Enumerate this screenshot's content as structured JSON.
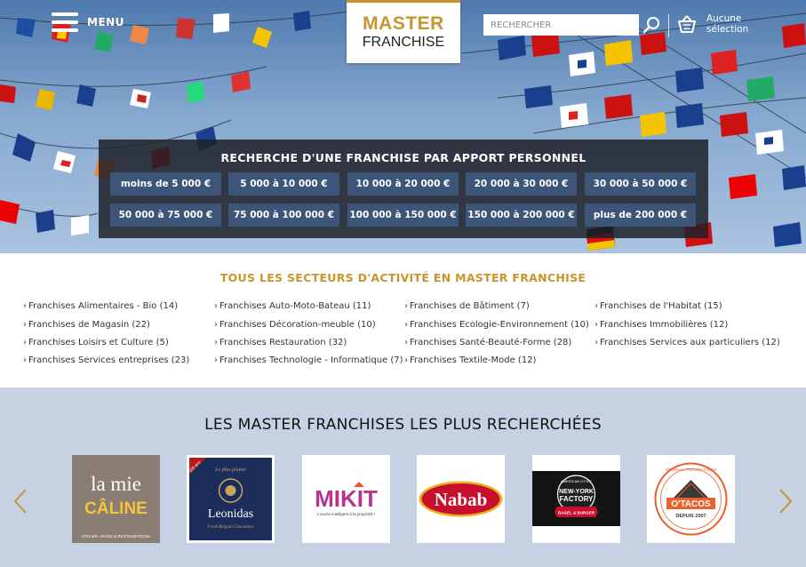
{
  "header": {
    "menu_label": "MENU",
    "logo_line1": "MASTER",
    "logo_line2": "FRANCHISE",
    "search_placeholder": "RECHERCHER",
    "cart_line1": "Aucune",
    "cart_line2": "sélection"
  },
  "apport": {
    "title": "RECHERCHE D'UNE FRANCHISE PAR APPORT PERSONNEL",
    "buttons": [
      "moins de 5 000  €",
      "5 000 à 10 000  €",
      "10 000 à 20 000  €",
      "20 000 à 30 000  €",
      "30 000 à 50 000  €",
      "50 000 à 75 000  €",
      "75 000 à 100 000  €",
      "100 000 à 150 000  €",
      "150 000 à 200 000  €",
      "plus de 200 000  €"
    ]
  },
  "sectors": {
    "title": "TOUS LES SECTEURS D'ACTIVITÉ EN MASTER FRANCHISE",
    "items": [
      "Franchises Alimentaires - Bio (14)",
      "Franchises Auto-Moto-Bateau (11)",
      "Franchises de Bâtiment (7)",
      "Franchises de l'Habitat (15)",
      "Franchises de Magasin (22)",
      "Franchises Décoration-meuble (10)",
      "Franchises Ecologie-Environnement (10)",
      "Franchises Immobilières (12)",
      "Franchises Loisirs et Culture (5)",
      "Franchises Restauration (32)",
      "Franchises Santé-Beauté-Forme (28)",
      "Franchises Services aux particuliers (12)",
      "Franchises Services entreprises (23)",
      "Franchises Technologie - Informatique (7)",
      "Franchises Textile-Mode (12)"
    ]
  },
  "popular": {
    "title": "LES MASTER FRANCHISES LES PLUS RECHERCHÉES",
    "brands": [
      {
        "name": "la mie CÂLINE",
        "line1": "la mie",
        "line2": "CÂLINE",
        "tagline": "ATELIER «PAINS & RESTAURATION»"
      },
      {
        "name": "Leonidas",
        "badge": "100 ans",
        "top": "Le plus plaisir",
        "line1": "Leonidas",
        "tagline": "Fresh Belgian Chocolates"
      },
      {
        "name": "MIKIT",
        "line1": "MIKIT",
        "tagline": "L'accès intelligent à la propriété !"
      },
      {
        "name": "Nabab",
        "line1": "Nabab"
      },
      {
        "name": "New-York Factory",
        "arc": "AMERICAN STYLE",
        "line1": "NEW-YORK",
        "line2": "FACTORY",
        "tagline": "BAGEL & BURGER"
      },
      {
        "name": "O'TACOS",
        "arc": "ORIGINAL FRENCH TACOS",
        "line1": "O'TACOS",
        "line2": "DEPUIS 2007"
      }
    ]
  },
  "colors": {
    "gold": "#c8952c",
    "button_blue": "#3c5578",
    "popular_bg": "#c6d2e3"
  }
}
